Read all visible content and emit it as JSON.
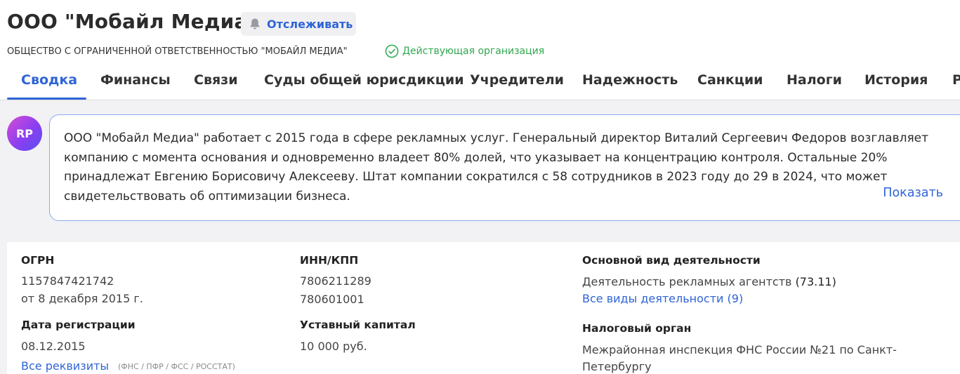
{
  "header": {
    "title": "ООО \"Мобайл Медиа\"",
    "track_label": "Отслеживать",
    "full_name": "ОБЩЕСТВО С ОГРАНИЧЕННОЙ ОТВЕТСТВЕННОСТЬЮ \"МОБАЙЛ МЕДИА\"",
    "status": "Действующая организация",
    "bell_icon": "bell-icon",
    "check_icon": "check-circle-icon"
  },
  "tabs": [
    {
      "label": "Сводка",
      "active": true
    },
    {
      "label": "Финансы"
    },
    {
      "label": "Связи"
    },
    {
      "label": "Суды общей юрисдикции"
    },
    {
      "label": "Учредители"
    },
    {
      "label": "Надежность"
    },
    {
      "label": "Санкции"
    },
    {
      "label": "Налоги"
    },
    {
      "label": "История"
    },
    {
      "label": "Р"
    }
  ],
  "summary": {
    "avatar_initials": "RP",
    "text": "ООО \"Мобайл Медиа\" работает с 2015 года в сфере рекламных услуг. Генеральный директор Виталий Сергеевич Федоров возглавляет компанию с момента основания и одновременно владеет 80% долей, что указывает на концентрацию контроля. Остальные 20% принадлежат Евгению Борисовичу Алексееву. Штат компании сократился с 58 сотрудников в 2023 году до 29 в 2024, что может свидетельствовать об оптимизации бизнеса.",
    "show_label": "Показать"
  },
  "info": {
    "ogrn_label": "ОГРН",
    "ogrn_value": "1157847421742",
    "ogrn_date": "от 8 декабря 2015 г.",
    "reg_date_label": "Дата регистрации",
    "reg_date_value": "08.12.2015",
    "all_details_link": "Все реквизиты",
    "all_details_sources": "(ФНС / ПФР / ФСС / РОССТАТ)",
    "inn_kpp_label": "ИНН/КПП",
    "inn_value": "7806211289",
    "kpp_value": "780601001",
    "capital_label": "Уставный капитал",
    "capital_value": "10 000 руб.",
    "activity_label": "Основной вид деятельности",
    "activity_value": "Деятельность рекламных агентств",
    "activity_code": "(73.11)",
    "all_activities_link": "Все виды деятельности (9)",
    "tax_label": "Налоговый орган",
    "tax_value_line1": "Межрайонная инспекция ФНС России №21 по Санкт-",
    "tax_value_line2": "Петербургу"
  },
  "colors": {
    "accent": "#2f64d6",
    "status_green": "#2fa84f",
    "summary_border": "#8ea8f0"
  }
}
